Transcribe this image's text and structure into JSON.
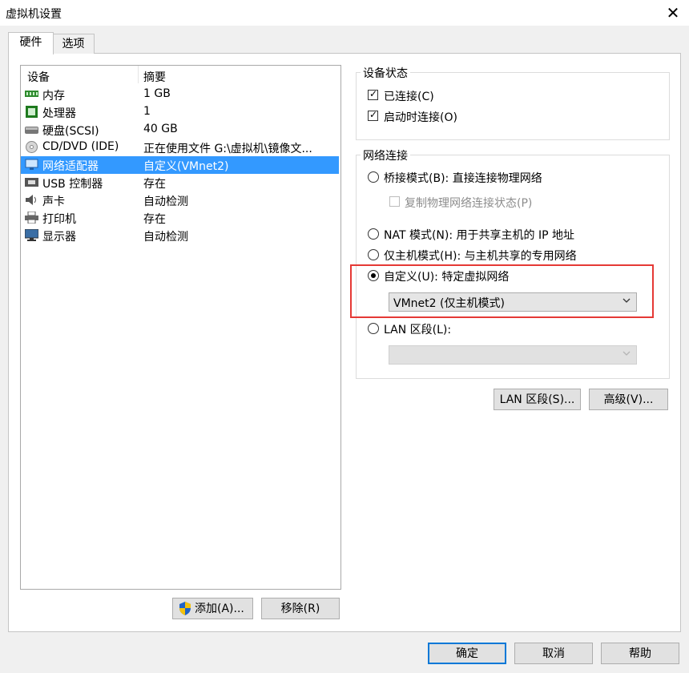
{
  "window": {
    "title": "虚拟机设置",
    "close_glyph": "✕"
  },
  "tabs": [
    {
      "label": "硬件"
    },
    {
      "label": "选项"
    }
  ],
  "device_list": {
    "headers": {
      "device": "设备",
      "summary": "摘要"
    },
    "rows": [
      {
        "name": "内存",
        "summary": "1 GB",
        "icon": "memory-icon"
      },
      {
        "name": "处理器",
        "summary": "1",
        "icon": "processor-icon"
      },
      {
        "name": "硬盘(SCSI)",
        "summary": "40 GB",
        "icon": "hard-disk-icon"
      },
      {
        "name": "CD/DVD (IDE)",
        "summary": "正在使用文件 G:\\虚拟机\\镜像文...",
        "icon": "cd-dvd-icon"
      },
      {
        "name": "网络适配器",
        "summary": "自定义(VMnet2)",
        "icon": "network-adapter-icon",
        "selected": true
      },
      {
        "name": "USB 控制器",
        "summary": "存在",
        "icon": "usb-icon"
      },
      {
        "name": "声卡",
        "summary": "自动检测",
        "icon": "sound-card-icon"
      },
      {
        "name": "打印机",
        "summary": "存在",
        "icon": "printer-icon"
      },
      {
        "name": "显示器",
        "summary": "自动检测",
        "icon": "display-icon"
      }
    ]
  },
  "list_buttons": {
    "add": "添加(A)...",
    "remove": "移除(R)"
  },
  "device_status": {
    "title": "设备状态",
    "connected": {
      "label": "已连接(C)",
      "checked": true
    },
    "connect_at_power_on": {
      "label": "启动时连接(O)",
      "checked": true
    }
  },
  "network": {
    "title": "网络连接",
    "bridged": {
      "label": "桥接模式(B): 直接连接物理网络",
      "selected": false
    },
    "replicate": {
      "label": "复制物理网络连接状态(P)",
      "checked": false,
      "disabled": true
    },
    "nat": {
      "label": "NAT 模式(N): 用于共享主机的 IP 地址",
      "selected": false
    },
    "host_only": {
      "label": "仅主机模式(H): 与主机共享的专用网络",
      "selected": false
    },
    "custom": {
      "label": "自定义(U): 特定虚拟网络",
      "selected": true,
      "value": "VMnet2 (仅主机模式)"
    },
    "lan_segment": {
      "label": "LAN 区段(L):",
      "selected": false,
      "value": ""
    }
  },
  "right_buttons": {
    "lan_segments": "LAN 区段(S)...",
    "advanced": "高级(V)..."
  },
  "footer": {
    "ok": "确定",
    "cancel": "取消",
    "help": "帮助"
  },
  "colors": {
    "selection": "#3399ff",
    "highlight_box": "#e53935",
    "primary_border": "#0078d7"
  }
}
